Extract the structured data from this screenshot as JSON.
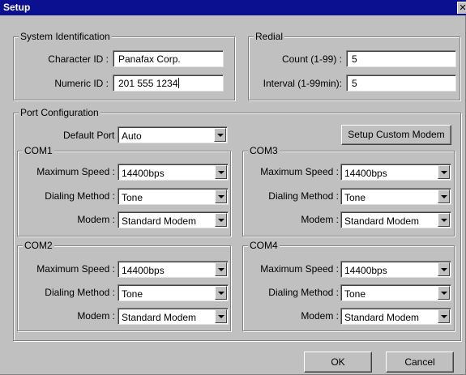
{
  "window": {
    "title": "Setup",
    "close_glyph": "✕"
  },
  "system_identification": {
    "legend": "System Identification",
    "character_id_label": "Character ID :",
    "character_id_value": "Panafax Corp.",
    "numeric_id_label": "Numeric ID :",
    "numeric_id_value": "201 555 1234"
  },
  "redial": {
    "legend": "Redial",
    "count_label": "Count (1-99) :",
    "count_value": "5",
    "interval_label": "Interval  (1-99min):",
    "interval_value": "5"
  },
  "port_configuration": {
    "legend": "Port Configuration",
    "default_port_label": "Default Port :",
    "default_port_value": "Auto",
    "setup_custom_modem_label": "Setup Custom Modem",
    "field_labels": {
      "max_speed": "Maximum Speed :",
      "dialing_method": "Dialing Method :",
      "modem": "Modem :"
    },
    "ports": [
      {
        "name": "COM1",
        "max_speed": "14400bps",
        "dialing_method": "Tone",
        "modem": "Standard Modem"
      },
      {
        "name": "COM2",
        "max_speed": "14400bps",
        "dialing_method": "Tone",
        "modem": "Standard Modem"
      },
      {
        "name": "COM3",
        "max_speed": "14400bps",
        "dialing_method": "Tone",
        "modem": "Standard Modem"
      },
      {
        "name": "COM4",
        "max_speed": "14400bps",
        "dialing_method": "Tone",
        "modem": "Standard Modem"
      }
    ]
  },
  "buttons": {
    "ok_label": "OK",
    "cancel_label": "Cancel"
  },
  "colors": {
    "title_bar": "#0a1090",
    "face": "#c0c0c0",
    "field": "#ffffff"
  },
  "icons": {
    "close": "close-icon",
    "dropdown": "chevron-down-icon"
  }
}
